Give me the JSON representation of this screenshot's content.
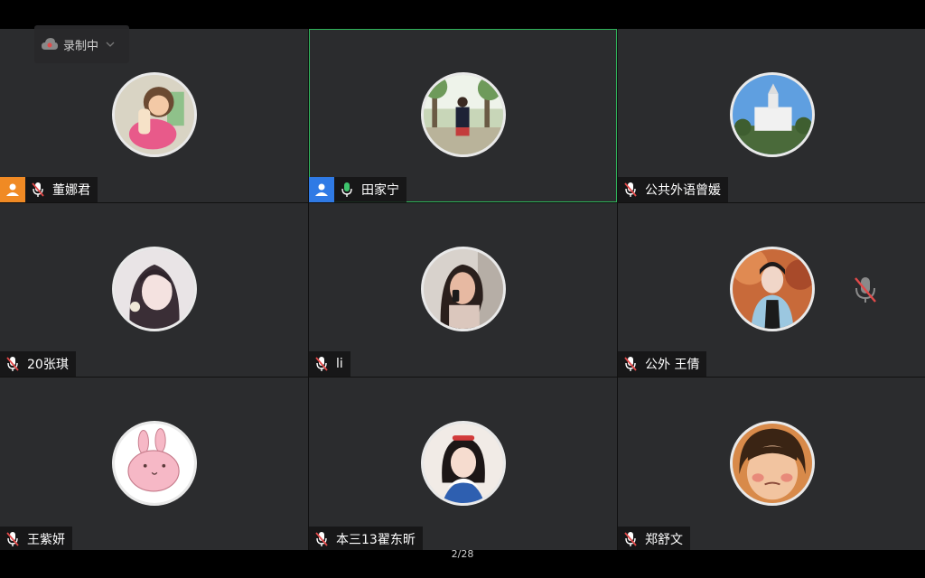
{
  "recording": {
    "label": "录制中"
  },
  "page_indicator": "2/28",
  "colors": {
    "active_border": "#2fb35a",
    "host_orange": "#f08a24",
    "cohost_blue": "#2f7ae5",
    "mic_active": "#3ec46d",
    "mic_muted": "#e24a4a"
  },
  "participants": [
    {
      "name": "董娜君",
      "badge": "host-orange",
      "mic": "muted",
      "avatar": "cartoon-girl-avatar"
    },
    {
      "name": "田家宁",
      "badge": "cohost-blue",
      "mic": "active",
      "active_speaker": true,
      "avatar": "outdoor-photo-avatar"
    },
    {
      "name": "公共外语曾媛",
      "badge": "",
      "mic": "muted",
      "avatar": "building-photo-avatar"
    },
    {
      "name": "20张琪",
      "badge": "",
      "mic": "muted",
      "avatar": "anime-girl-avatar"
    },
    {
      "name": "li",
      "badge": "",
      "mic": "muted",
      "avatar": "portrait-photo-avatar"
    },
    {
      "name": "公外 王倩",
      "badge": "",
      "mic": "muted",
      "avatar": "selfie-photo-avatar"
    },
    {
      "name": "王紫妍",
      "badge": "",
      "mic": "muted",
      "avatar": "pink-rabbit-avatar"
    },
    {
      "name": "本三13翟东昕",
      "badge": "",
      "mic": "muted",
      "avatar": "snow-white-avatar"
    },
    {
      "name": "郑舒文",
      "badge": "",
      "mic": "muted",
      "avatar": "child-face-avatar"
    }
  ]
}
